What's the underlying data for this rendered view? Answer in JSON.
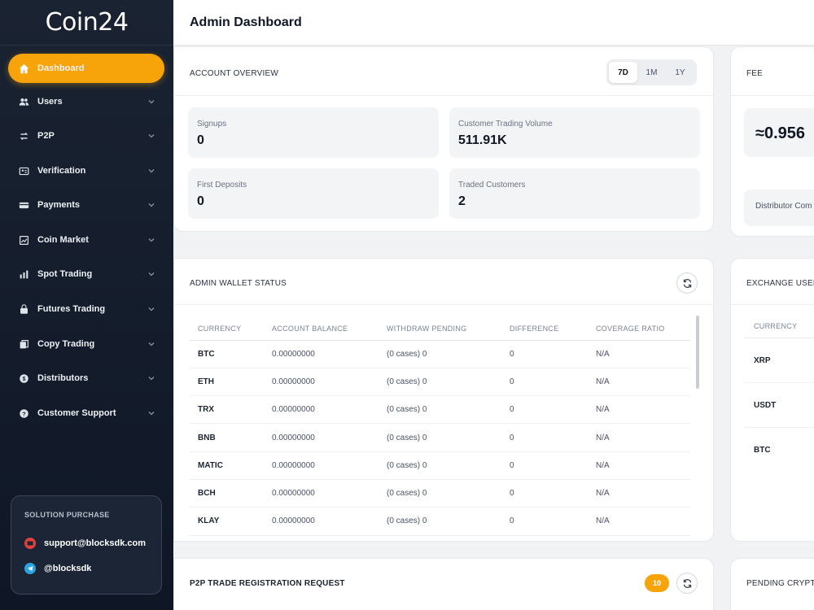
{
  "app": {
    "logo": "Coin24"
  },
  "sidebar": {
    "items": [
      {
        "label": "Dashboard",
        "icon": "home-icon"
      },
      {
        "label": "Users",
        "icon": "users-icon"
      },
      {
        "label": "P2P",
        "icon": "swap-icon"
      },
      {
        "label": "Verification",
        "icon": "id-card-icon"
      },
      {
        "label": "Payments",
        "icon": "credit-card-icon"
      },
      {
        "label": "Coin Market",
        "icon": "market-icon"
      },
      {
        "label": "Spot Trading",
        "icon": "bar-chart-icon"
      },
      {
        "label": "Futures Trading",
        "icon": "bag-icon"
      },
      {
        "label": "Copy Trading",
        "icon": "copy-icon"
      },
      {
        "label": "Distributors",
        "icon": "coin-icon"
      },
      {
        "label": "Customer Support",
        "icon": "help-icon"
      }
    ],
    "solution": {
      "title": "SOLUTION PURCHASE",
      "email": "support@blocksdk.com",
      "telegram": "@blocksdk"
    }
  },
  "header": {
    "title": "Admin Dashboard"
  },
  "account_overview": {
    "title": "ACCOUNT OVERVIEW",
    "tabs": [
      "7D",
      "1M",
      "1Y"
    ],
    "active_tab": "7D",
    "stats": [
      {
        "label": "Signups",
        "value": "0"
      },
      {
        "label": "Customer Trading Volume",
        "value": "511.91K"
      },
      {
        "label": "First Deposits",
        "value": "0"
      },
      {
        "label": "Traded Customers",
        "value": "2"
      }
    ]
  },
  "fee": {
    "title": "FEE",
    "value": "≈0.956",
    "distributor_label": "Distributor Com"
  },
  "wallet_status": {
    "title": "ADMIN WALLET STATUS",
    "columns": [
      "CURRENCY",
      "ACCOUNT BALANCE",
      "WITHDRAW PENDING",
      "DIFFERENCE",
      "COVERAGE RATIO"
    ],
    "rows": [
      [
        "BTC",
        "0.00000000",
        "(0 cases) 0",
        "0",
        "N/A"
      ],
      [
        "ETH",
        "0.00000000",
        "(0 cases) 0",
        "0",
        "N/A"
      ],
      [
        "TRX",
        "0.00000000",
        "(0 cases) 0",
        "0",
        "N/A"
      ],
      [
        "BNB",
        "0.00000000",
        "(0 cases) 0",
        "0",
        "N/A"
      ],
      [
        "MATIC",
        "0.00000000",
        "(0 cases) 0",
        "0",
        "N/A"
      ],
      [
        "BCH",
        "0.00000000",
        "(0 cases) 0",
        "0",
        "N/A"
      ],
      [
        "KLAY",
        "0.00000000",
        "(0 cases) 0",
        "0",
        "N/A"
      ]
    ]
  },
  "exchange_user": {
    "title": "EXCHANGE USER",
    "column": "CURRENCY",
    "rows": [
      "XRP",
      "USDT",
      "BTC"
    ]
  },
  "p2p_request": {
    "title": "P2P TRADE REGISTRATION REQUEST",
    "badge": "10"
  },
  "pending_crypto": {
    "title": "PENDING CRYPTO"
  }
}
